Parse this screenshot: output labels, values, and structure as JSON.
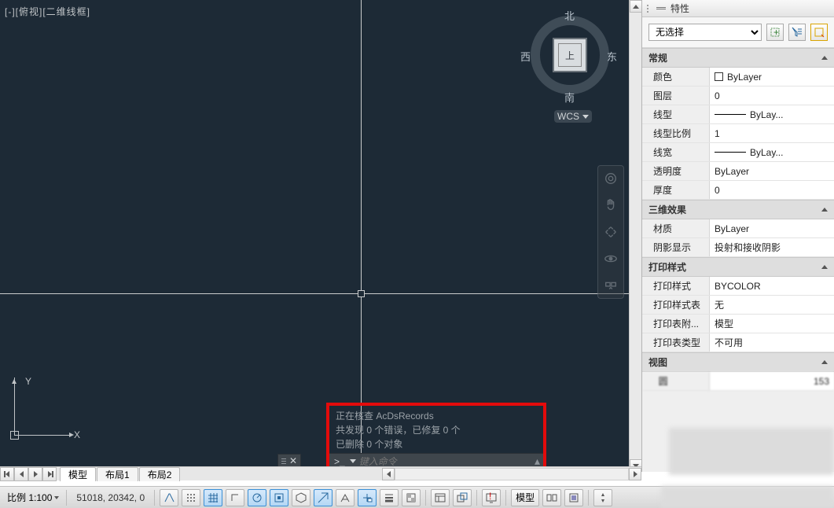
{
  "viewport_label": "[-][俯视][二维线框]",
  "viewcube": {
    "top": "上",
    "n": "北",
    "s": "南",
    "e": "东",
    "w": "西",
    "wcs": "WCS"
  },
  "ucs": {
    "x": "X",
    "y": "Y"
  },
  "command": {
    "line1": "正在核查 AcDsRecords",
    "line2": "共发现 0 个错误，已修复 0 个",
    "line3": "已删除 0 个对象",
    "prompt": ">_",
    "placeholder": "键入命令",
    "close": "✕"
  },
  "layout_tabs": {
    "model": "模型",
    "layout1": "布局1",
    "layout2": "布局2"
  },
  "palette": {
    "title": "特性",
    "selection": "无选择",
    "groups": {
      "general": {
        "header": "常规",
        "rows": [
          {
            "name": "颜色",
            "value": "ByLayer",
            "swatch": true
          },
          {
            "name": "图层",
            "value": "0"
          },
          {
            "name": "线型",
            "value": "ByLay...",
            "line": true
          },
          {
            "name": "线型比例",
            "value": "1"
          },
          {
            "name": "线宽",
            "value": "ByLay...",
            "line": true
          },
          {
            "name": "透明度",
            "value": "ByLayer"
          },
          {
            "name": "厚度",
            "value": "0"
          }
        ]
      },
      "threed": {
        "header": "三维效果",
        "rows": [
          {
            "name": "材质",
            "value": "ByLayer"
          },
          {
            "name": "阴影显示",
            "value": "投射和接收阴影"
          }
        ]
      },
      "plot": {
        "header": "打印样式",
        "rows": [
          {
            "name": "打印样式",
            "value": "BYCOLOR"
          },
          {
            "name": "打印样式表",
            "value": "无"
          },
          {
            "name": "打印表附...",
            "value": "模型"
          },
          {
            "name": "打印表类型",
            "value": "不可用"
          }
        ]
      },
      "view": {
        "header": "视图",
        "partial": "圆",
        "partial_val": "153"
      }
    }
  },
  "status": {
    "scale_label": "比例 1:100 ",
    "coords": "51018, 20342, 0",
    "model_btn": "模型"
  }
}
